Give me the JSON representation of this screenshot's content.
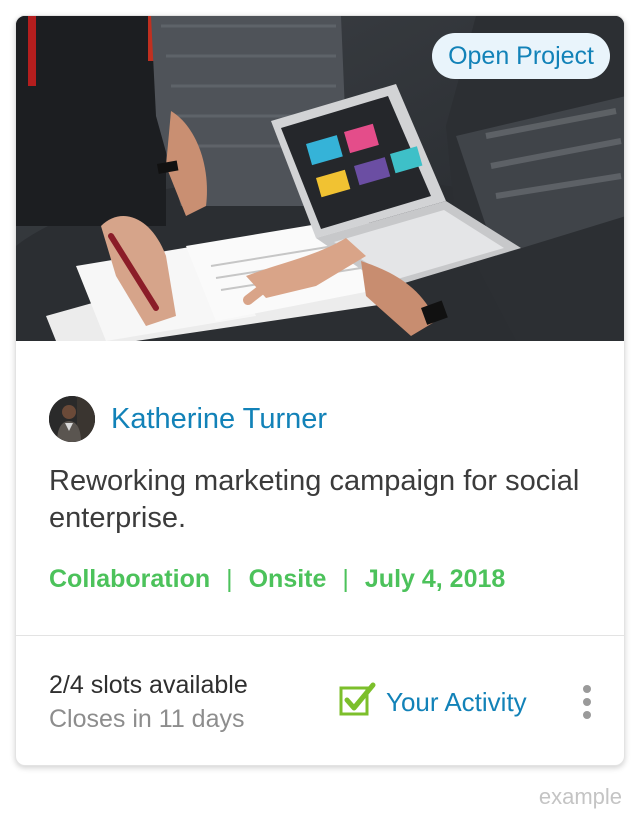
{
  "project": {
    "badge_label": "Open Project",
    "author_name": "Katherine Turner",
    "description": "Reworking marketing campaign for social enterprise.",
    "tags": [
      "Collaboration",
      "Onsite",
      "July 4, 2018"
    ],
    "tag_separator": "|"
  },
  "footer": {
    "slots_text": "2/4 slots available",
    "closes_text": "Closes in 11 days",
    "activity_label": "Your Activity"
  },
  "caption": "example",
  "icons": {
    "checkbox": "checkbox-checked-icon",
    "more": "vertical-ellipsis-icon"
  },
  "colors": {
    "link_blue": "#1282b8",
    "tag_green": "#4cc25b",
    "badge_bg": "#e9f4fb",
    "check_green": "#7cbf2b"
  }
}
